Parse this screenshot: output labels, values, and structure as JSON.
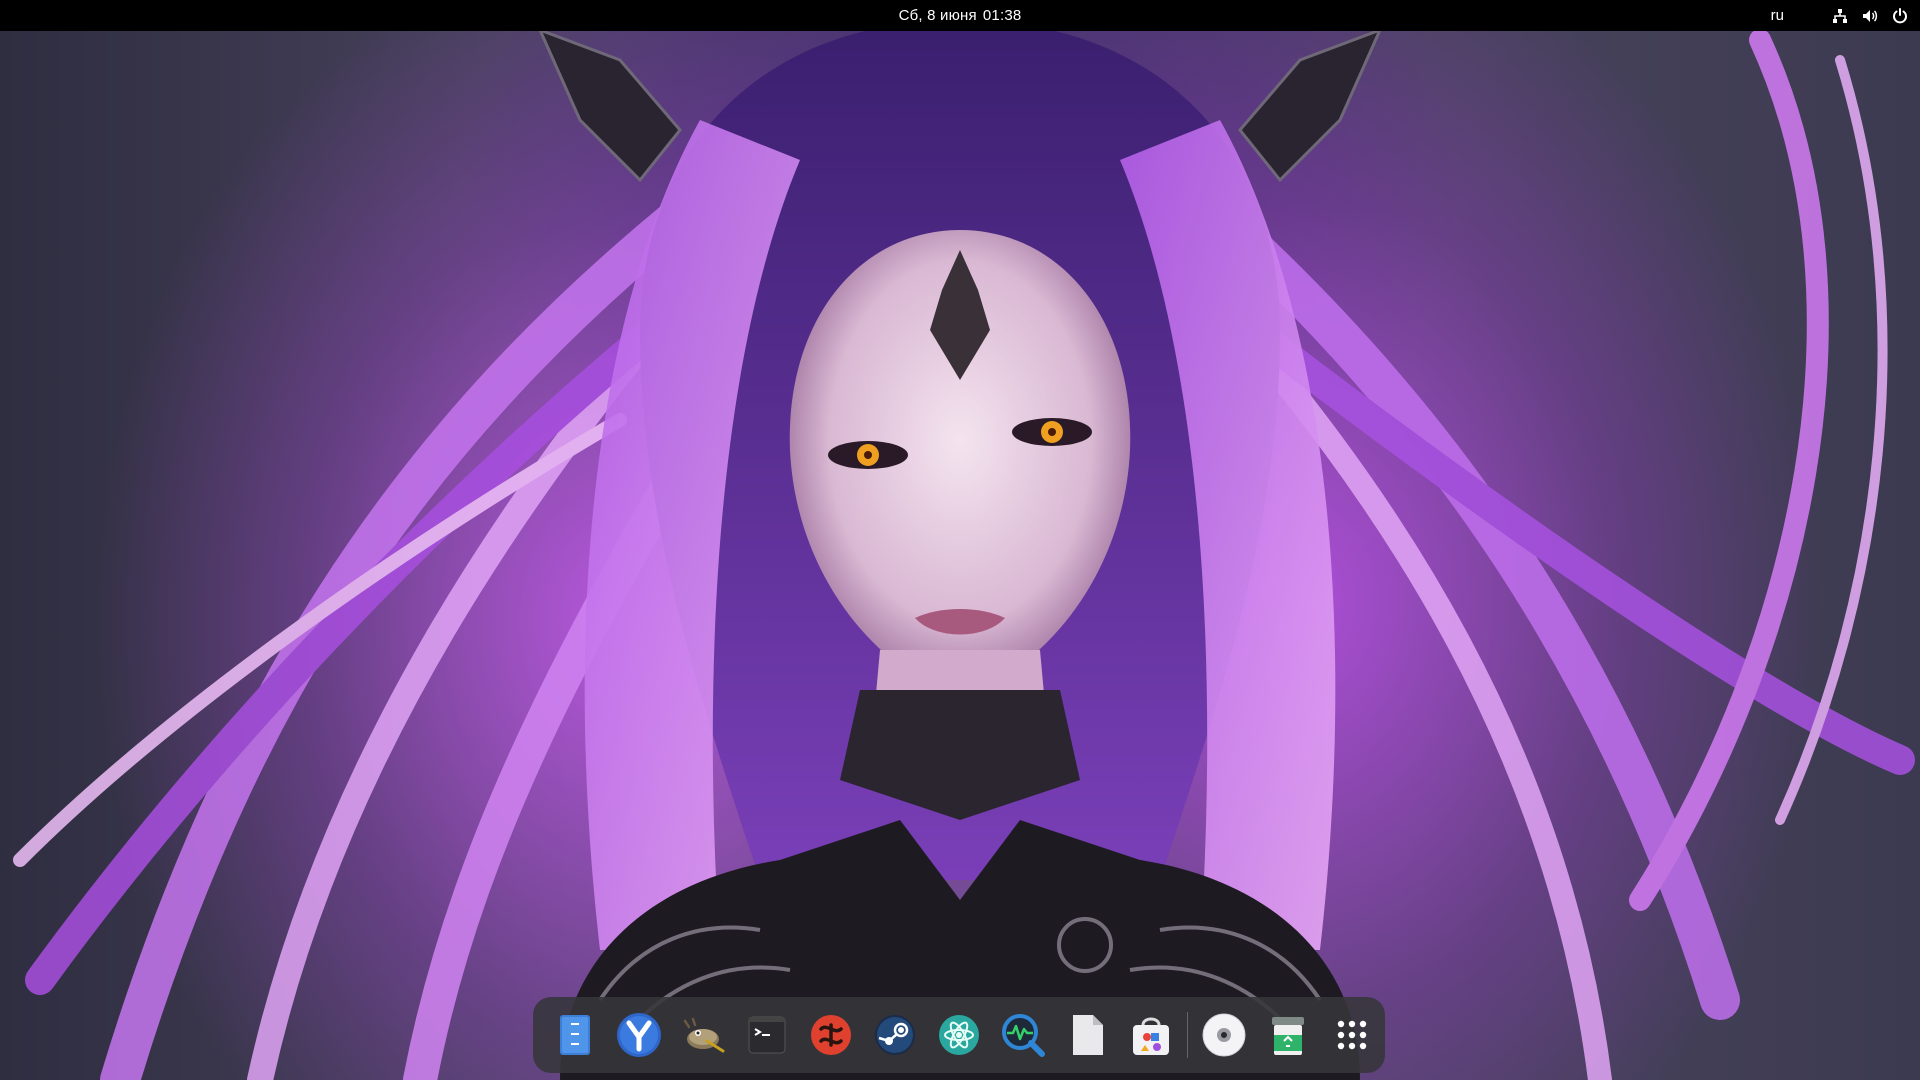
{
  "topbar": {
    "day_date": "Сб, 8 июня",
    "time": "01:38",
    "keyboard_layout": "ru",
    "tray_icons": [
      "network-wired-icon",
      "volume-icon",
      "power-icon"
    ]
  },
  "dock": {
    "apps": [
      {
        "name": "files-icon",
        "label": "Files"
      },
      {
        "name": "yandex-browser-icon",
        "label": "Yandex Browser"
      },
      {
        "name": "gimp-icon",
        "label": "GIMP"
      },
      {
        "name": "terminal-icon",
        "label": "Terminal"
      },
      {
        "name": "typora-icon",
        "label": "Editor"
      },
      {
        "name": "steam-icon",
        "label": "Steam"
      },
      {
        "name": "atom-icon",
        "label": "Atom"
      },
      {
        "name": "system-monitor-icon",
        "label": "System Monitor"
      },
      {
        "name": "text-document-icon",
        "label": "Document"
      },
      {
        "name": "software-store-icon",
        "label": "Software"
      }
    ],
    "system": [
      {
        "name": "optical-disc-icon",
        "label": "Disc"
      },
      {
        "name": "trash-icon",
        "label": "Trash"
      },
      {
        "name": "show-apps-icon",
        "label": "Show Applications"
      }
    ]
  },
  "colors": {
    "topbar_bg": "#000000",
    "dock_bg": "#36363a",
    "accent_purple": "#b45ee8"
  }
}
